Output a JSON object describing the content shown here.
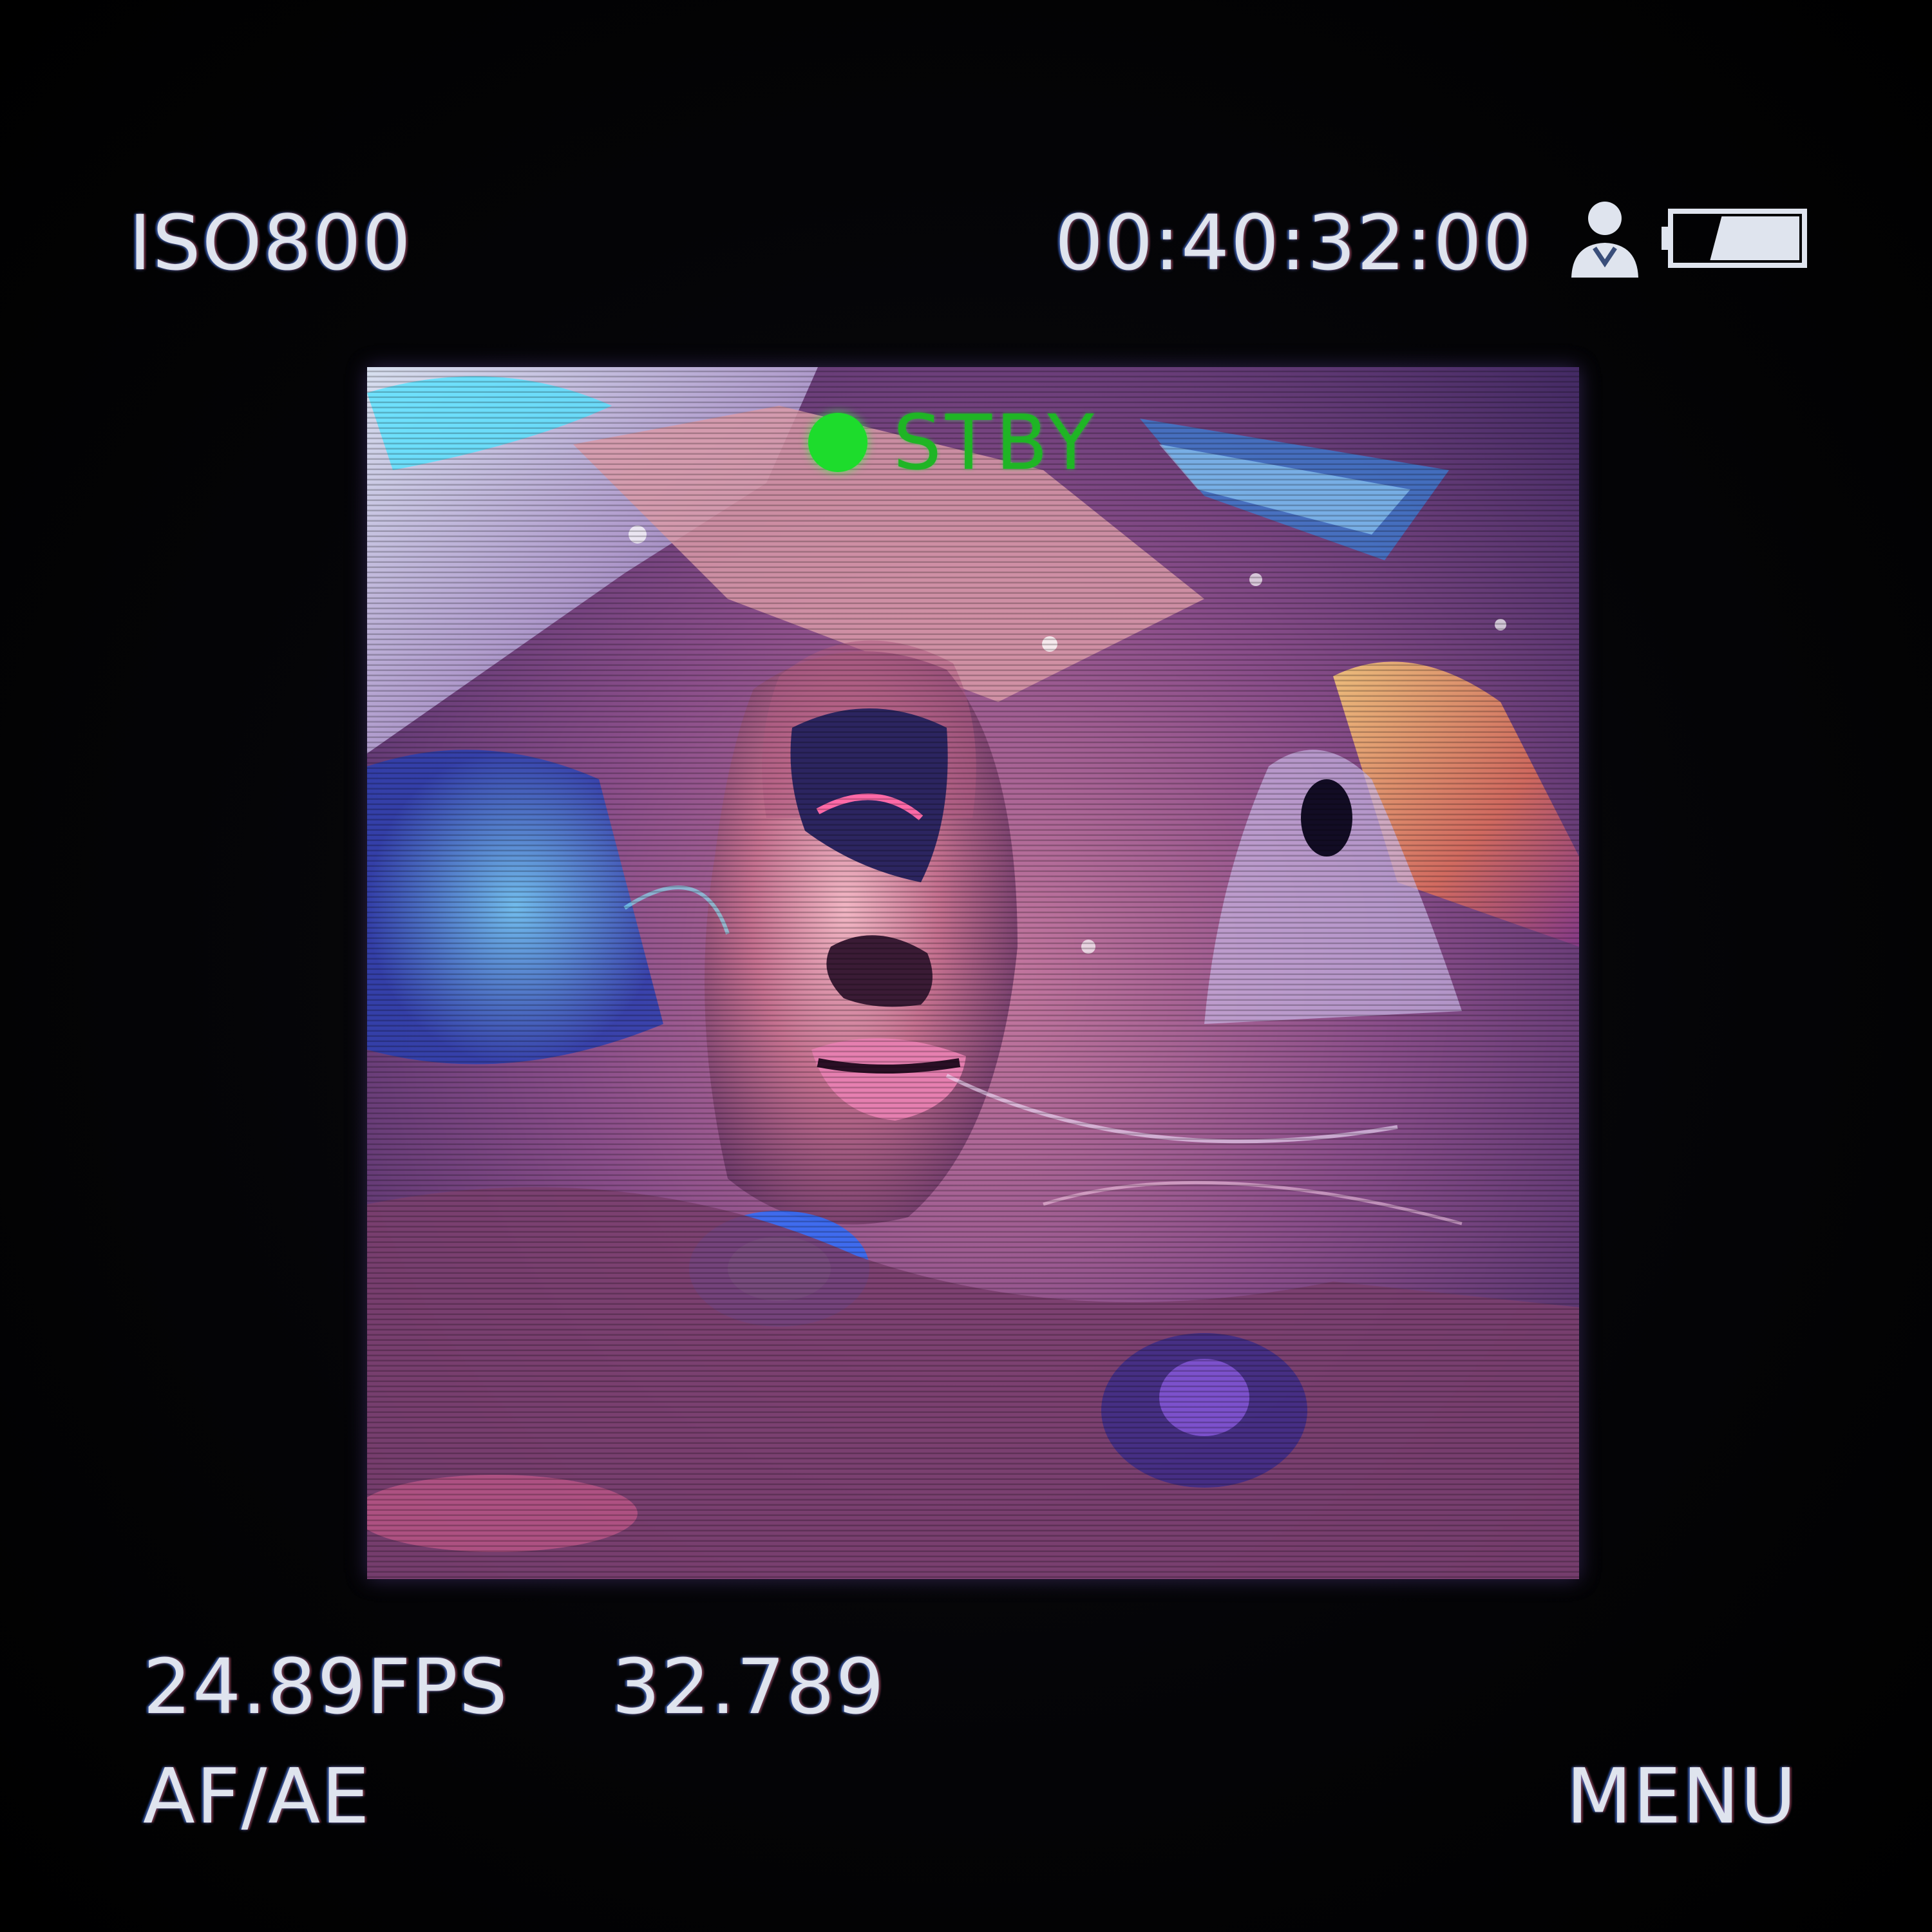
{
  "osd": {
    "iso": "ISO800",
    "timecode": "00:40:32:00",
    "fps": "24.89FPS",
    "counter": "32.789",
    "af_ae": "AF/AE",
    "menu": "MENU"
  },
  "status": {
    "label": "STBY",
    "dot_color": "#1ddc2c"
  },
  "icons": {
    "user": "user-icon",
    "battery": "battery-icon",
    "battery_level": 0.7
  },
  "colors": {
    "background": "#000000",
    "osd_text": "#dfe4ee",
    "status_text": "#1fb525"
  }
}
